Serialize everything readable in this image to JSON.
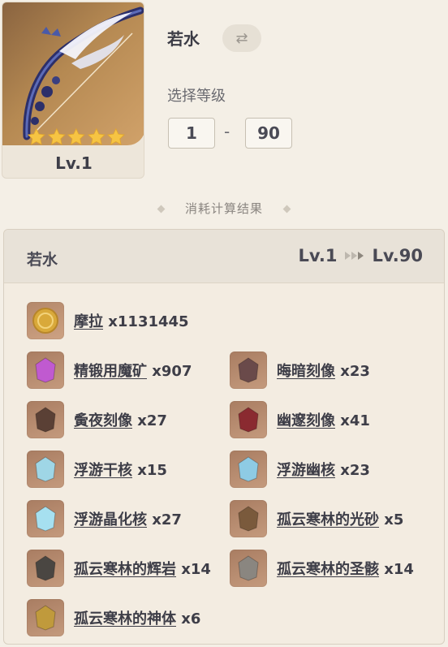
{
  "weapon": {
    "name": "若水",
    "level_label": "Lv.1",
    "stars": 5
  },
  "level_select": {
    "label": "选择等级",
    "from": "1",
    "separator": "-",
    "to": "90"
  },
  "section_title": "消耗计算结果",
  "result": {
    "name": "若水",
    "from_level": "Lv.1",
    "to_level": "Lv.90",
    "materials": [
      {
        "name": "摩拉",
        "qty": "x1131445",
        "icon": "mora-coin-icon",
        "color": "#d9a93a"
      },
      {
        "name": "精锻用魔矿",
        "qty": "x907",
        "icon": "crystal-ore-icon",
        "color": "#c05ad0"
      },
      {
        "name": "晦暗刻像",
        "qty": "x23",
        "icon": "dim-statue-icon",
        "color": "#6a4a4a"
      },
      {
        "name": "夤夜刻像",
        "qty": "x27",
        "icon": "night-statue-icon",
        "color": "#5a4035"
      },
      {
        "name": "幽邃刻像",
        "qty": "x41",
        "icon": "deep-statue-icon",
        "color": "#8a2a30"
      },
      {
        "name": "浮游干核",
        "qty": "x15",
        "icon": "floating-core-icon",
        "color": "#9fd6e6"
      },
      {
        "name": "浮游幽核",
        "qty": "x23",
        "icon": "floating-dim-core-icon",
        "color": "#8ecbe4"
      },
      {
        "name": "浮游晶化核",
        "qty": "x27",
        "icon": "floating-crystal-core-icon",
        "color": "#a6e0f0"
      },
      {
        "name": "孤云寒林的光砂",
        "qty": "x5",
        "icon": "guyun-sand-icon",
        "color": "#7a5a3c"
      },
      {
        "name": "孤云寒林的辉岩",
        "qty": "x14",
        "icon": "guyun-rock-icon",
        "color": "#4a4642"
      },
      {
        "name": "孤云寒林的圣骸",
        "qty": "x14",
        "icon": "guyun-relic-icon",
        "color": "#8a8680"
      },
      {
        "name": "孤云寒林的神体",
        "qty": "x6",
        "icon": "guyun-divine-icon",
        "color": "#c09a3c"
      }
    ]
  }
}
